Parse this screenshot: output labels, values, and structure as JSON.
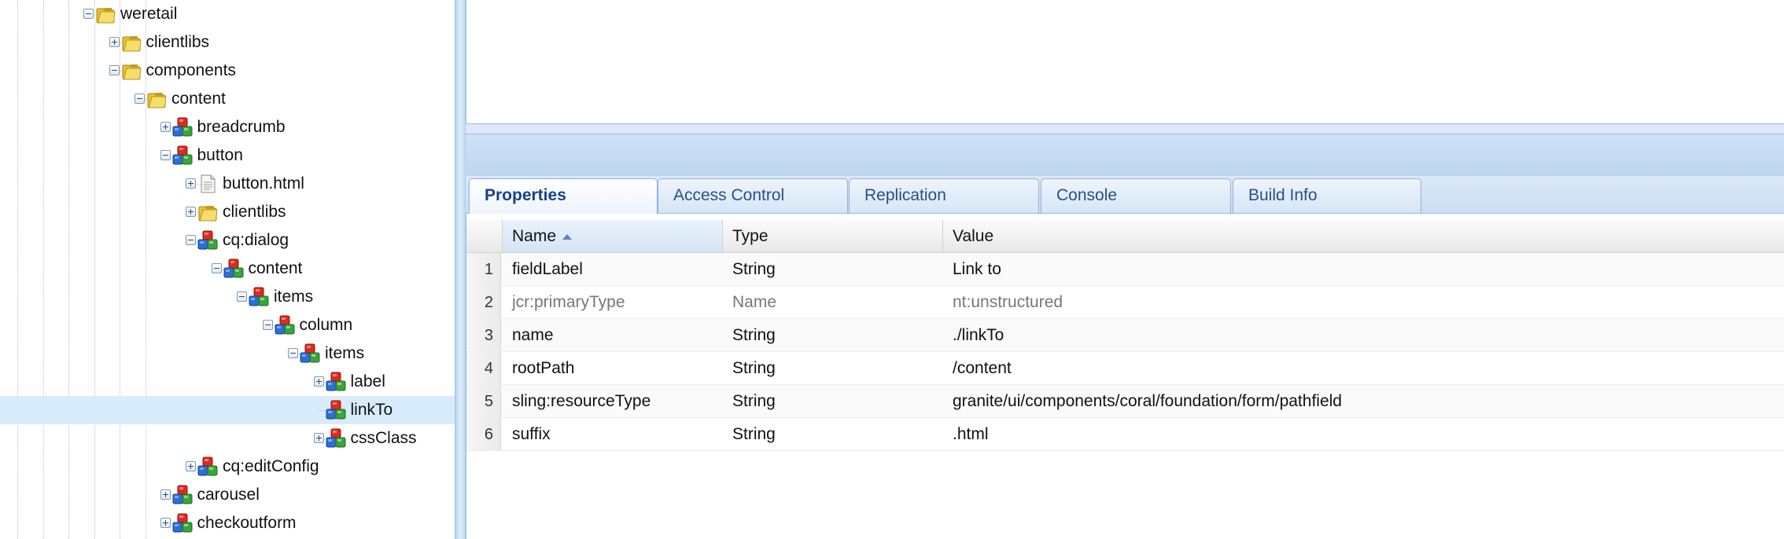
{
  "tree": {
    "nodes": [
      {
        "label": "weretail",
        "icon": "folder",
        "expander": "minus",
        "depth": 2
      },
      {
        "label": "clientlibs",
        "icon": "folder",
        "expander": "plus",
        "depth": 3
      },
      {
        "label": "components",
        "icon": "folder",
        "expander": "minus",
        "depth": 3
      },
      {
        "label": "content",
        "icon": "folder",
        "expander": "minus",
        "depth": 4
      },
      {
        "label": "breadcrumb",
        "icon": "component",
        "expander": "plus",
        "depth": 5
      },
      {
        "label": "button",
        "icon": "component",
        "expander": "minus",
        "depth": 5
      },
      {
        "label": "button.html",
        "icon": "file",
        "expander": "plus",
        "depth": 6
      },
      {
        "label": "clientlibs",
        "icon": "folder",
        "expander": "plus",
        "depth": 6
      },
      {
        "label": "cq:dialog",
        "icon": "component",
        "expander": "minus",
        "depth": 6
      },
      {
        "label": "content",
        "icon": "component",
        "expander": "minus",
        "depth": 7
      },
      {
        "label": "items",
        "icon": "component",
        "expander": "minus",
        "depth": 8
      },
      {
        "label": "column",
        "icon": "component",
        "expander": "minus",
        "depth": 9
      },
      {
        "label": "items",
        "icon": "component",
        "expander": "minus",
        "depth": 10
      },
      {
        "label": "label",
        "icon": "component",
        "expander": "plus",
        "depth": 11
      },
      {
        "label": "linkTo",
        "icon": "component",
        "expander": "none",
        "depth": 11,
        "selected": true
      },
      {
        "label": "cssClass",
        "icon": "component",
        "expander": "plus",
        "depth": 11
      },
      {
        "label": "cq:editConfig",
        "icon": "component",
        "expander": "plus",
        "depth": 6
      },
      {
        "label": "carousel",
        "icon": "component",
        "expander": "plus",
        "depth": 5
      },
      {
        "label": "checkoutform",
        "icon": "component",
        "expander": "plus",
        "depth": 5
      }
    ]
  },
  "tabs": [
    {
      "label": "Properties",
      "active": true
    },
    {
      "label": "Access Control",
      "active": false
    },
    {
      "label": "Replication",
      "active": false
    },
    {
      "label": "Console",
      "active": false
    },
    {
      "label": "Build Info",
      "active": false
    }
  ],
  "grid": {
    "headers": {
      "name": "Name",
      "type": "Type",
      "value": "Value"
    },
    "rows": [
      {
        "num": "1",
        "name": "fieldLabel",
        "type": "String",
        "value": "Link to",
        "dim": false
      },
      {
        "num": "2",
        "name": "jcr:primaryType",
        "type": "Name",
        "value": "nt:unstructured",
        "dim": true
      },
      {
        "num": "3",
        "name": "name",
        "type": "String",
        "value": "./linkTo",
        "dim": false
      },
      {
        "num": "4",
        "name": "rootPath",
        "type": "String",
        "value": "/content",
        "dim": false
      },
      {
        "num": "5",
        "name": "sling:resourceType",
        "type": "String",
        "value": "granite/ui/components/coral/foundation/form/pathfield",
        "dim": false
      },
      {
        "num": "6",
        "name": "suffix",
        "type": "String",
        "value": ".html",
        "dim": false
      }
    ]
  },
  "colors": {
    "accent": "#15428b",
    "selection": "#d9ecfb",
    "border": "#99bbe8"
  }
}
